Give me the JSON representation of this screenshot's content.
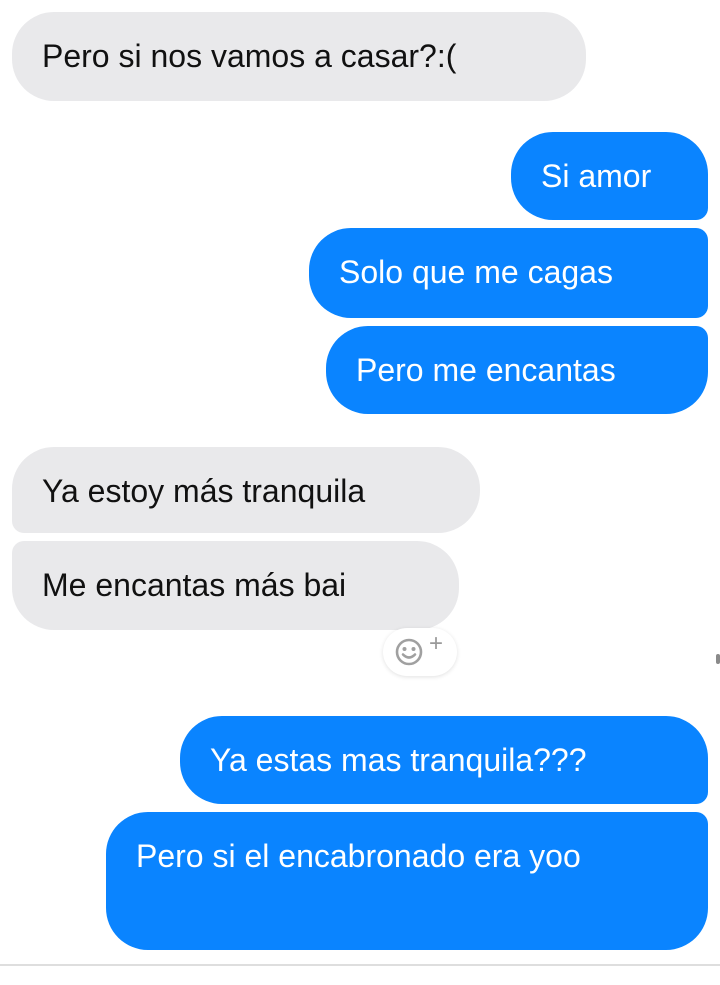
{
  "conversation": {
    "messages": [
      {
        "sender": "other",
        "text": "Pero si nos vamos a casar?:("
      },
      {
        "sender": "me",
        "text": "Si amor"
      },
      {
        "sender": "me",
        "text": "Solo que me cagas"
      },
      {
        "sender": "me",
        "text": "Pero me encantas"
      },
      {
        "sender": "other",
        "text": "Ya estoy más tranquila"
      },
      {
        "sender": "other",
        "text": "Me encantas más bai"
      },
      {
        "sender": "me",
        "text": "Ya estas mas tranquila???"
      },
      {
        "sender": "me",
        "text": "Pero si el encabronado era yoo"
      }
    ],
    "reaction_button": {
      "icon": "smiley-add-icon",
      "plus": "+"
    }
  },
  "colors": {
    "outgoing_bubble": "#0a84ff",
    "incoming_bubble": "#e9e9eb",
    "background": "#ffffff"
  }
}
